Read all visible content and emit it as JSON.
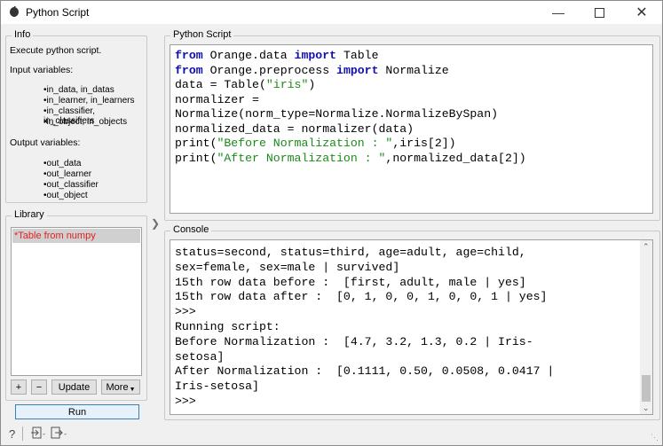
{
  "window": {
    "title": "Python Script"
  },
  "info": {
    "heading": "Info",
    "description": "Execute python script.",
    "input_heading": "Input variables:",
    "inputs": [
      "in_data, in_datas",
      "in_learner, in_learners",
      "in_classifier, in_classifiers",
      "in_object, in_objects"
    ],
    "output_heading": "Output variables:",
    "outputs": [
      "out_data",
      "out_learner",
      "out_classifier",
      "out_object"
    ]
  },
  "library": {
    "heading": "Library",
    "items": [
      "*Table from numpy"
    ],
    "add_label": "+",
    "remove_label": "−",
    "update_label": "Update",
    "more_label": "More"
  },
  "run_label": "Run",
  "script": {
    "heading": "Python Script",
    "lines": [
      [
        {
          "t": "from",
          "c": "kw"
        },
        {
          "t": " Orange.data "
        },
        {
          "t": "import",
          "c": "kw"
        },
        {
          "t": " Table"
        }
      ],
      [
        {
          "t": "from",
          "c": "kw"
        },
        {
          "t": " Orange.preprocess "
        },
        {
          "t": "import",
          "c": "kw"
        },
        {
          "t": " Normalize"
        }
      ],
      [
        {
          "t": "data = Table("
        },
        {
          "t": "\"iris\"",
          "c": "str"
        },
        {
          "t": ")"
        }
      ],
      [
        {
          "t": "normalizer ="
        }
      ],
      [
        {
          "t": "Normalize(norm_type=Normalize.NormalizeBySpan)"
        }
      ],
      [
        {
          "t": "normalized_data = normalizer(data)"
        }
      ],
      [
        {
          "t": "print("
        },
        {
          "t": "\"Before Normalization : \"",
          "c": "str"
        },
        {
          "t": ",iris[2])"
        }
      ],
      [
        {
          "t": "print("
        },
        {
          "t": "\"After Normalization : \"",
          "c": "str"
        },
        {
          "t": ",normalized_data[2])"
        }
      ]
    ]
  },
  "console": {
    "heading": "Console",
    "lines": [
      "status=second, status=third, age=adult, age=child,",
      "sex=female, sex=male | survived]",
      "15th row data before :  [first, adult, male | yes]",
      "15th row data after :  [0, 1, 0, 0, 1, 0, 0, 1 | yes]",
      ">>>",
      "Running script:",
      "Before Normalization :  [4.7, 3.2, 1.3, 0.2 | Iris-",
      "setosa]",
      "After Normalization :  [0.1111, 0.50, 0.0508, 0.0417 |",
      "Iris-setosa]",
      ">>>"
    ]
  },
  "colors": {
    "keyword": "#1010b0",
    "string": "#1a8a1a",
    "selected_item": "#e32020"
  }
}
